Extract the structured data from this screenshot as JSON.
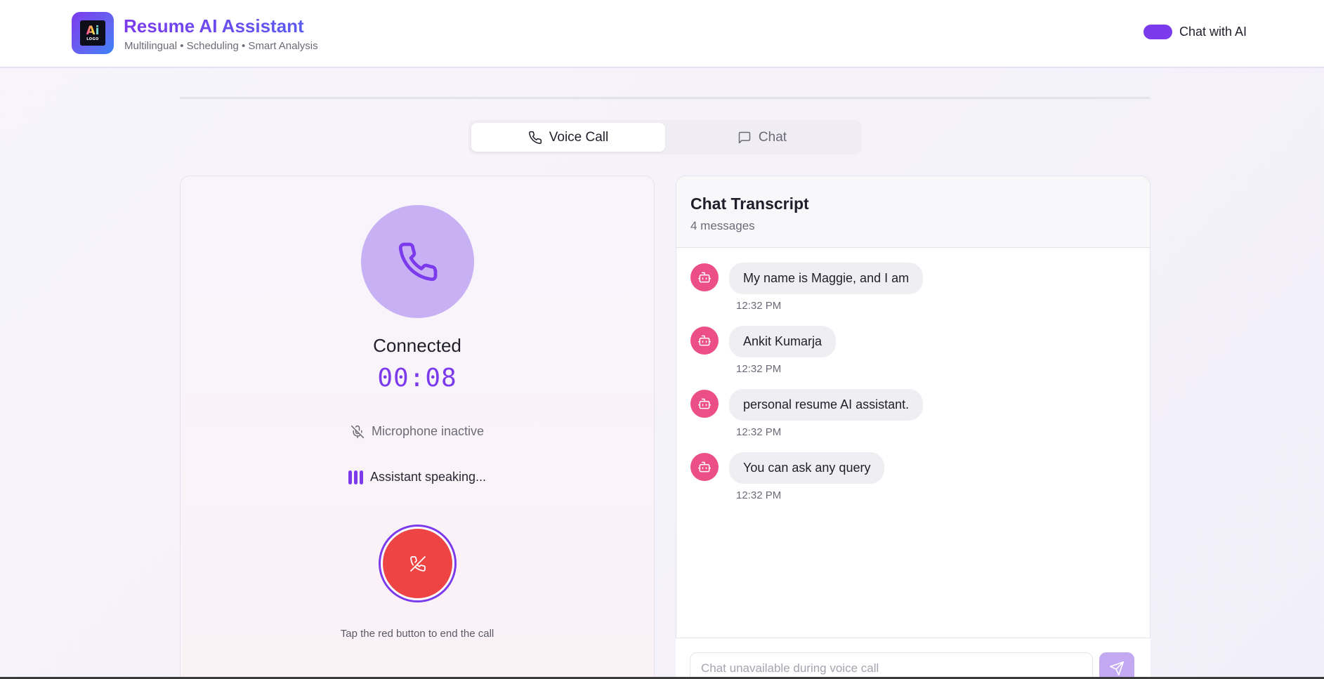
{
  "header": {
    "logo_text": "Ai",
    "logo_subtext": "LOGO",
    "title": "Resume AI Assistant",
    "subtitle": "Multilingual • Scheduling • Smart Analysis",
    "toggle_label": "Chat with AI",
    "toggle_on": true
  },
  "tabs": [
    {
      "label": "Voice Call",
      "icon": "phone-icon",
      "active": true
    },
    {
      "label": "Chat",
      "icon": "message-icon",
      "active": false
    }
  ],
  "call": {
    "status": "Connected",
    "timer": "00:08",
    "mic_status": "Microphone inactive",
    "speaking_status": "Assistant speaking...",
    "end_hint": "Tap the red button to end the call"
  },
  "transcript": {
    "title": "Chat Transcript",
    "count": "4 messages",
    "messages": [
      {
        "sender": "assistant",
        "avatar_icon": "bot-icon",
        "text": "My name is Maggie, and I am",
        "time": "12:32 PM"
      },
      {
        "sender": "assistant",
        "avatar_icon": "bot-icon",
        "text": "Ankit Kumarja",
        "time": "12:32 PM"
      },
      {
        "sender": "assistant",
        "avatar_icon": "bot-icon",
        "text": "personal resume AI assistant.",
        "time": "12:32 PM"
      },
      {
        "sender": "assistant",
        "avatar_icon": "bot-icon",
        "text": "You can ask any query",
        "time": "12:32 PM"
      }
    ],
    "input_placeholder": "Chat unavailable during voice call"
  },
  "colors": {
    "accent": "#7c3aed",
    "end_call": "#ef4444",
    "avatar": "#ec4f86",
    "phone_circle": "#c8b0f4"
  }
}
